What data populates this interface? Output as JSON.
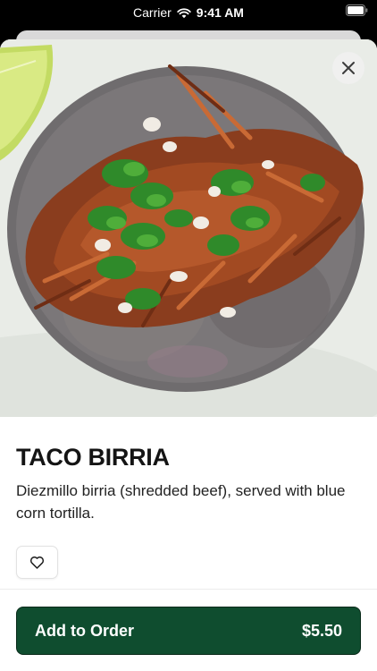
{
  "status_bar": {
    "carrier": "Carrier",
    "time": "9:41 AM",
    "icons": [
      "wifi-icon",
      "battery-icon"
    ]
  },
  "item": {
    "image": "taco-birria-photo",
    "name": "TACO BIRRIA",
    "description": "Diezmillo birria (shredded beef), served with blue corn tortilla."
  },
  "actions": {
    "close_icon": "close-icon",
    "favorite_icon": "heart-icon",
    "add_label": "Add to Order",
    "price": "$5.50"
  },
  "colors": {
    "primary": "#0f4d2f",
    "title": "#141414"
  }
}
